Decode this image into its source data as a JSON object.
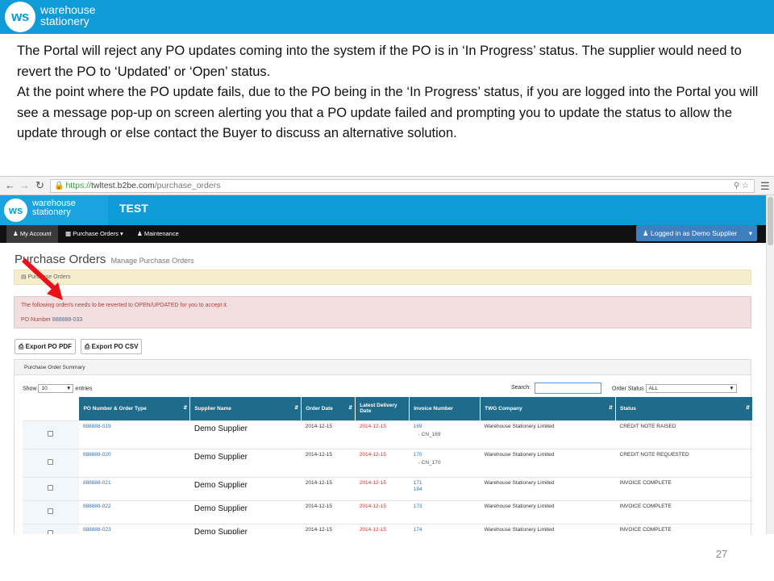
{
  "slide": {
    "logo_abbrev": "ws",
    "logo_line1": "warehouse",
    "logo_line2": "stationery",
    "paragraph1": "The Portal will reject any PO updates coming into the system if the PO is in ‘In Progress’ status. The supplier would need to revert the PO to ‘Updated’ or ‘Open’ status.",
    "paragraph2": "At the point where the PO update fails, due to the PO being in the ‘In Progress’ status, if you are logged into the Portal you will see a message pop-up on screen alerting you that a PO update failed and prompting you to update the status to allow the update through or else contact the Buyer to discuss an alternative solution.",
    "page_number": "27",
    "colors": {
      "brand_blue": "#0f9ad8",
      "arrow_red": "#e8131a"
    }
  },
  "browser": {
    "url_scheme": "https://",
    "url_host": "twltest.b2be.com",
    "url_path": "/purchase_orders",
    "back_icon": "arrow-left-icon",
    "forward_icon": "arrow-right-icon",
    "reload_icon": "reload-icon",
    "menu_icon": "hamburger-icon"
  },
  "app": {
    "logo_abbrev": "ws",
    "logo_line1": "warehouse",
    "logo_line2": "stationery",
    "title": "TEST",
    "nav": [
      "My Account",
      "Purchase Orders",
      "Maintenance"
    ],
    "logged_in": "Logged in as Demo Supplier",
    "page_title": "Purchase Orders",
    "page_subtitle": "Manage Purchase Orders",
    "breadcrumb": "Purchase Orders",
    "alert_line1": "The following order/s needs to be reverted to OPEN/UPDATED for you to accept it.",
    "alert_po_label": "PO Number",
    "alert_po_value": "888888-033",
    "export_pdf": "Export PO PDF",
    "export_csv": "Export PO CSV",
    "summary_title": "Purchase Order Summary",
    "show_label": "Show",
    "show_value": "10",
    "entries_label": "entries",
    "search_label": "Search:",
    "order_status_label": "Order Status",
    "order_status_value": "ALL"
  },
  "table": {
    "columns": [
      "PO Number & Order Type",
      "Supplier Name",
      "Order Date",
      "Latest Delivery Date",
      "Invoice Number",
      "TWG Company",
      "Status"
    ],
    "rows": [
      {
        "po": "888888-019",
        "supplier": "Demo Supplier",
        "order_date": "2014-12-15",
        "delivery": "2014-12-15",
        "invoice": "169",
        "invoice2": "- CN_169",
        "company": "Warehouse Stationery Limited",
        "status": "CREDIT NOTE RAISED"
      },
      {
        "po": "888888-020",
        "supplier": "Demo Supplier",
        "order_date": "2014-12-15",
        "delivery": "2014-12-15",
        "invoice": "170",
        "invoice2": "- CN_170",
        "company": "Warehouse Stationery Limited",
        "status": "CREDIT NOTE REQUESTED"
      },
      {
        "po": "888888-021",
        "supplier": "Demo Supplier",
        "order_date": "2014-12-15",
        "delivery": "2014-12-15",
        "invoice": "171",
        "invoice2": "184",
        "company": "Warehouse Stationery Limited",
        "status": "INVOICE COMPLETE"
      },
      {
        "po": "888888-022",
        "supplier": "Demo Supplier",
        "order_date": "2014-12-15",
        "delivery": "2014-12-15",
        "invoice": "173",
        "invoice2": "",
        "company": "Warehouse Stationery Limited",
        "status": "INVOICE COMPLETE"
      },
      {
        "po": "888888-023",
        "supplier": "Demo Supplier",
        "order_date": "2014-12-15",
        "delivery": "2014-12-15",
        "invoice": "174",
        "invoice2": "",
        "company": "Warehouse Stationery Limited",
        "status": "INVOICE COMPLETE"
      }
    ]
  }
}
